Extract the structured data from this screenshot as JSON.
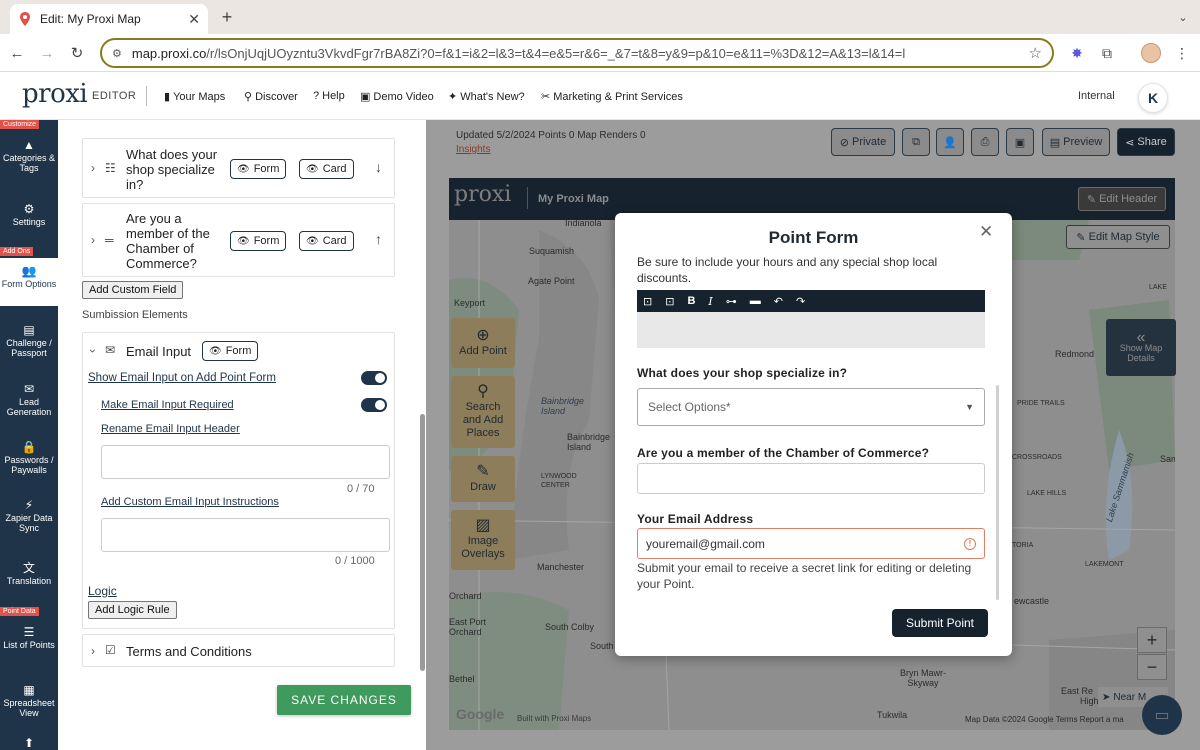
{
  "browser": {
    "tab_title": "Edit: My Proxi Map",
    "url_host": "map.proxi.co",
    "url_path": "/r/lsOnjUqjUOyzntu3VkvdFgr7rBA8Zi?0=f&1=i&2=l&3=t&4=e&5=r&6=_&7=t&8=y&9=p&10=e&11=%3D&12=A&13=l&14=l"
  },
  "appnav": {
    "logo": "proxi",
    "editor_label": "EDITOR",
    "links": [
      "Your Maps",
      "Discover",
      "Help",
      "Demo Video",
      "What's New?",
      "Marketing & Print Services"
    ],
    "internal": "Internal",
    "avatar_letter": "K"
  },
  "rail": {
    "tags": [
      "Customize",
      "Add Ons",
      "Point Data"
    ],
    "items": [
      {
        "label": "Categories & Tags",
        "icon": "shapes-icon"
      },
      {
        "label": "Settings",
        "icon": "gear-icon"
      },
      {
        "label": "Form Options",
        "icon": "users-icon"
      },
      {
        "label": "Challenge / Passport",
        "icon": "passport-icon"
      },
      {
        "label": "Lead Generation",
        "icon": "mail-icon"
      },
      {
        "label": "Passwords / Paywalls",
        "icon": "lock-icon"
      },
      {
        "label": "Zapier Data Sync",
        "icon": "bolt-icon"
      },
      {
        "label": "Translation",
        "icon": "translate-icon"
      },
      {
        "label": "List of Points",
        "icon": "list-icon"
      },
      {
        "label": "Spreadsheet View",
        "icon": "grid-icon"
      }
    ]
  },
  "panel": {
    "field1": {
      "title": "What does your shop specialize in?",
      "form": "Form",
      "card": "Card"
    },
    "field2": {
      "title": "Are you a member of the Chamber of Commerce?",
      "form": "Form",
      "card": "Card"
    },
    "add_custom_field": "Add Custom Field",
    "submission_label": "Sumbission Elements",
    "email": {
      "title": "Email Input",
      "form": "Form",
      "show_link": "Show Email Input on Add Point Form",
      "required_link": "Make Email Input Required",
      "rename_link": "Rename Email Input Header",
      "rename_counter": "0 / 70",
      "instructions_link": "Add Custom Email Input Instructions",
      "instructions_counter": "0 / 1000",
      "logic_link": "Logic",
      "add_logic": "Add Logic Rule"
    },
    "terms": "Terms and Conditions",
    "save": "SAVE CHANGES"
  },
  "map": {
    "status": "Updated 5/2/2024   Points 0   Map Renders 0",
    "insights": "Insights",
    "toolbar": [
      "Private",
      "",
      "",
      "",
      "",
      "Preview",
      "Share"
    ],
    "header_logo": "proxi",
    "header_name": "My Proxi Map",
    "edit_header": "Edit Header",
    "edit_map_style": "Edit Map Style",
    "tools": [
      "Add Point",
      "Search and Add Places",
      "Draw",
      "Image Overlays"
    ],
    "show_details": "Show Map Details",
    "near_me": "Near M",
    "google": "Google",
    "built_with": "Built with Proxi Maps",
    "footer": "Map Data ©2024 Google   Terms   Report a ma",
    "labels": [
      "Indianola",
      "Suquamish",
      "Agate Point",
      "Keyport",
      "Bainbridge Island",
      "Bainbridge Island",
      "LYNWOOD CENTER",
      "Manchester",
      "Orchard",
      "East Port Orchard",
      "South Colby",
      "South",
      "Bethel",
      "Redmond",
      "PRIDE TRAILS",
      "Sam",
      "CROSSROADS",
      "LAKE HILLS",
      "Lake Sammamish",
      "TORIA",
      "LAKEMONT",
      "ewcastle",
      "Highlan",
      "East Re",
      "Bryn Mawr-Skyway",
      "Tukwila",
      "LAKE"
    ]
  },
  "modal": {
    "title": "Point Form",
    "description": "Be sure to include your hours and any special shop local discounts.",
    "q1": "What does your shop specialize in?",
    "select_placeholder": "Select Options*",
    "q2": "Are you a member of the Chamber of Commerce?",
    "email_label": "Your Email Address",
    "email_value": "youremail@gmail.com",
    "email_help": "Submit your email to receive a secret link for editing or deleting your Point.",
    "submit": "Submit Point"
  }
}
